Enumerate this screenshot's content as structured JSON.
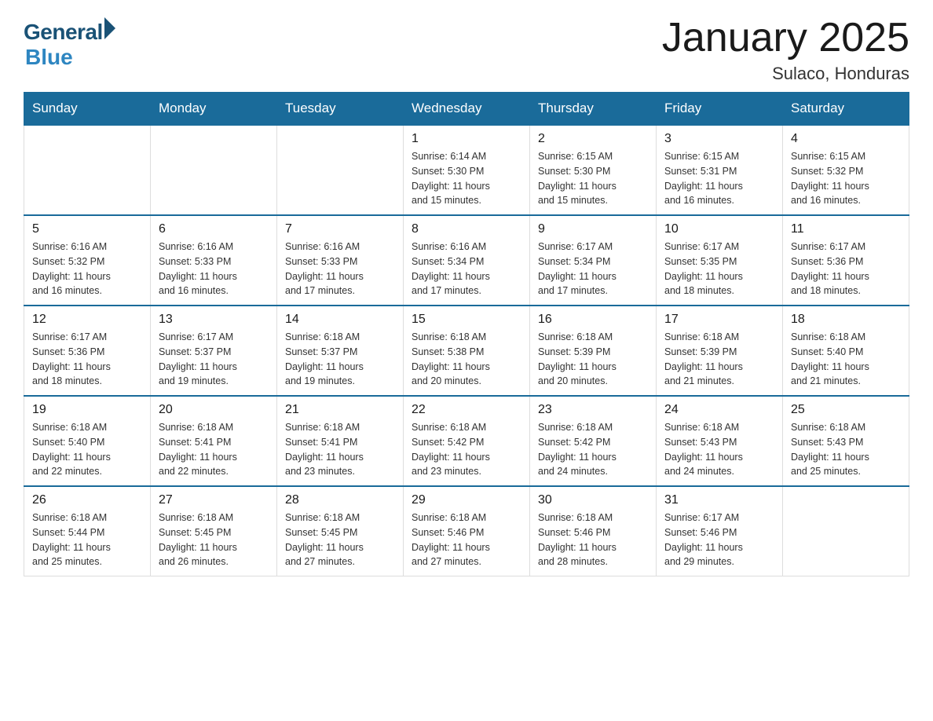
{
  "logo": {
    "general": "General",
    "blue": "Blue"
  },
  "title": "January 2025",
  "subtitle": "Sulaco, Honduras",
  "weekdays": [
    "Sunday",
    "Monday",
    "Tuesday",
    "Wednesday",
    "Thursday",
    "Friday",
    "Saturday"
  ],
  "weeks": [
    [
      {
        "day": "",
        "info": ""
      },
      {
        "day": "",
        "info": ""
      },
      {
        "day": "",
        "info": ""
      },
      {
        "day": "1",
        "info": "Sunrise: 6:14 AM\nSunset: 5:30 PM\nDaylight: 11 hours\nand 15 minutes."
      },
      {
        "day": "2",
        "info": "Sunrise: 6:15 AM\nSunset: 5:30 PM\nDaylight: 11 hours\nand 15 minutes."
      },
      {
        "day": "3",
        "info": "Sunrise: 6:15 AM\nSunset: 5:31 PM\nDaylight: 11 hours\nand 16 minutes."
      },
      {
        "day": "4",
        "info": "Sunrise: 6:15 AM\nSunset: 5:32 PM\nDaylight: 11 hours\nand 16 minutes."
      }
    ],
    [
      {
        "day": "5",
        "info": "Sunrise: 6:16 AM\nSunset: 5:32 PM\nDaylight: 11 hours\nand 16 minutes."
      },
      {
        "day": "6",
        "info": "Sunrise: 6:16 AM\nSunset: 5:33 PM\nDaylight: 11 hours\nand 16 minutes."
      },
      {
        "day": "7",
        "info": "Sunrise: 6:16 AM\nSunset: 5:33 PM\nDaylight: 11 hours\nand 17 minutes."
      },
      {
        "day": "8",
        "info": "Sunrise: 6:16 AM\nSunset: 5:34 PM\nDaylight: 11 hours\nand 17 minutes."
      },
      {
        "day": "9",
        "info": "Sunrise: 6:17 AM\nSunset: 5:34 PM\nDaylight: 11 hours\nand 17 minutes."
      },
      {
        "day": "10",
        "info": "Sunrise: 6:17 AM\nSunset: 5:35 PM\nDaylight: 11 hours\nand 18 minutes."
      },
      {
        "day": "11",
        "info": "Sunrise: 6:17 AM\nSunset: 5:36 PM\nDaylight: 11 hours\nand 18 minutes."
      }
    ],
    [
      {
        "day": "12",
        "info": "Sunrise: 6:17 AM\nSunset: 5:36 PM\nDaylight: 11 hours\nand 18 minutes."
      },
      {
        "day": "13",
        "info": "Sunrise: 6:17 AM\nSunset: 5:37 PM\nDaylight: 11 hours\nand 19 minutes."
      },
      {
        "day": "14",
        "info": "Sunrise: 6:18 AM\nSunset: 5:37 PM\nDaylight: 11 hours\nand 19 minutes."
      },
      {
        "day": "15",
        "info": "Sunrise: 6:18 AM\nSunset: 5:38 PM\nDaylight: 11 hours\nand 20 minutes."
      },
      {
        "day": "16",
        "info": "Sunrise: 6:18 AM\nSunset: 5:39 PM\nDaylight: 11 hours\nand 20 minutes."
      },
      {
        "day": "17",
        "info": "Sunrise: 6:18 AM\nSunset: 5:39 PM\nDaylight: 11 hours\nand 21 minutes."
      },
      {
        "day": "18",
        "info": "Sunrise: 6:18 AM\nSunset: 5:40 PM\nDaylight: 11 hours\nand 21 minutes."
      }
    ],
    [
      {
        "day": "19",
        "info": "Sunrise: 6:18 AM\nSunset: 5:40 PM\nDaylight: 11 hours\nand 22 minutes."
      },
      {
        "day": "20",
        "info": "Sunrise: 6:18 AM\nSunset: 5:41 PM\nDaylight: 11 hours\nand 22 minutes."
      },
      {
        "day": "21",
        "info": "Sunrise: 6:18 AM\nSunset: 5:41 PM\nDaylight: 11 hours\nand 23 minutes."
      },
      {
        "day": "22",
        "info": "Sunrise: 6:18 AM\nSunset: 5:42 PM\nDaylight: 11 hours\nand 23 minutes."
      },
      {
        "day": "23",
        "info": "Sunrise: 6:18 AM\nSunset: 5:42 PM\nDaylight: 11 hours\nand 24 minutes."
      },
      {
        "day": "24",
        "info": "Sunrise: 6:18 AM\nSunset: 5:43 PM\nDaylight: 11 hours\nand 24 minutes."
      },
      {
        "day": "25",
        "info": "Sunrise: 6:18 AM\nSunset: 5:43 PM\nDaylight: 11 hours\nand 25 minutes."
      }
    ],
    [
      {
        "day": "26",
        "info": "Sunrise: 6:18 AM\nSunset: 5:44 PM\nDaylight: 11 hours\nand 25 minutes."
      },
      {
        "day": "27",
        "info": "Sunrise: 6:18 AM\nSunset: 5:45 PM\nDaylight: 11 hours\nand 26 minutes."
      },
      {
        "day": "28",
        "info": "Sunrise: 6:18 AM\nSunset: 5:45 PM\nDaylight: 11 hours\nand 27 minutes."
      },
      {
        "day": "29",
        "info": "Sunrise: 6:18 AM\nSunset: 5:46 PM\nDaylight: 11 hours\nand 27 minutes."
      },
      {
        "day": "30",
        "info": "Sunrise: 6:18 AM\nSunset: 5:46 PM\nDaylight: 11 hours\nand 28 minutes."
      },
      {
        "day": "31",
        "info": "Sunrise: 6:17 AM\nSunset: 5:46 PM\nDaylight: 11 hours\nand 29 minutes."
      },
      {
        "day": "",
        "info": ""
      }
    ]
  ]
}
